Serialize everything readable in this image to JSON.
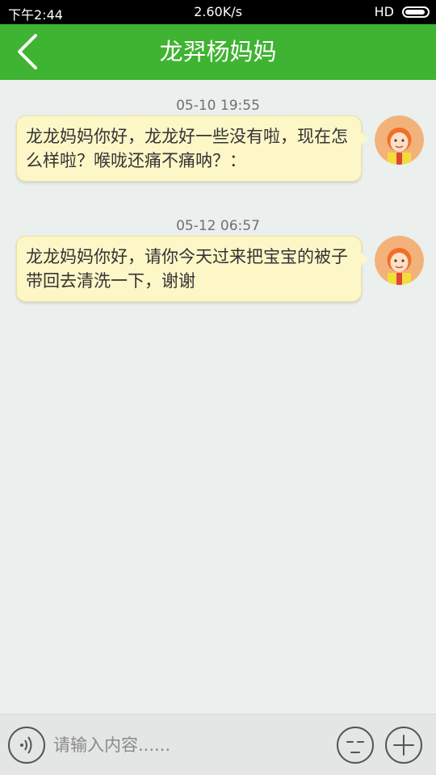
{
  "status_bar": {
    "time": "下午2:44",
    "speed": "2.60K/s",
    "signal": "HD"
  },
  "header": {
    "title": "龙羿杨妈妈",
    "back_icon": "chevron-left-icon"
  },
  "messages": [
    {
      "time": "05-10 19:55",
      "text": "龙龙妈妈你好，龙龙好一些没有啦，现在怎么样啦？喉咙还痛不痛呐？："
    },
    {
      "time": "05-12 06:57",
      "text": "龙龙妈妈你好，请你今天过来把宝宝的被子带回去清洗一下，谢谢"
    }
  ],
  "input_bar": {
    "placeholder": "请输入内容......",
    "value": "",
    "voice_icon": "voice-icon",
    "emoji_icon": "emoji-icon",
    "plus_icon": "plus-icon"
  },
  "colors": {
    "header_green": "#3fb332",
    "bubble_bg": "#fdf7c8",
    "background": "#ebefed"
  }
}
